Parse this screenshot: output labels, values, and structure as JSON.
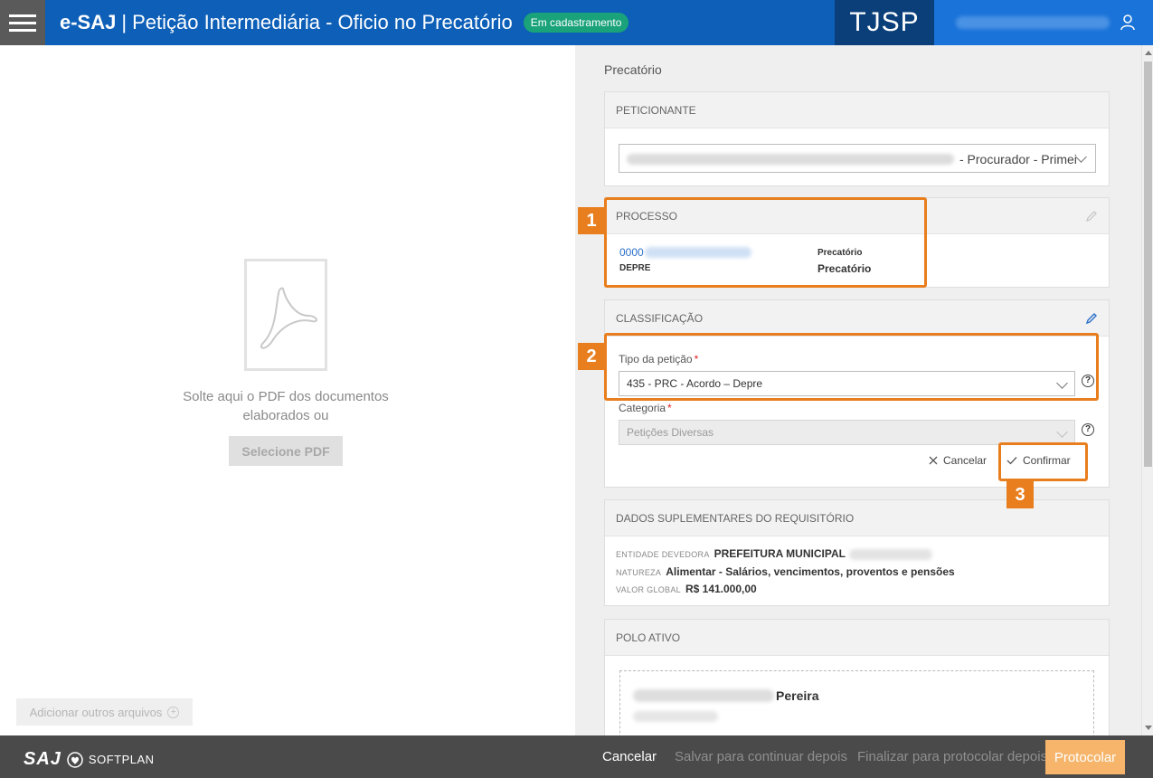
{
  "header": {
    "brand": "e-SAJ",
    "separator": "|",
    "title": "Petição Intermediária - Oficio no Precatório",
    "status": "Em cadastramento",
    "court": "TJSP"
  },
  "left": {
    "drop_text_line1": "Solte aqui o PDF dos documentos",
    "drop_text_line2": "elaborados ou",
    "select_pdf": "Selecione PDF",
    "add_files": "Adicionar outros arquivos"
  },
  "right": {
    "section_title": "Precatório",
    "peticionante": {
      "header": "PETICIONANTE",
      "selected_suffix": "- Procurador - Primei"
    },
    "processo": {
      "header": "PROCESSO",
      "number_prefix": "0000",
      "origin": "DEPRE",
      "class_label": "Precatório",
      "class_value": "Precatório"
    },
    "classificacao": {
      "header": "CLASSIFICAÇÃO",
      "tipo_label": "Tipo da petição",
      "tipo_value": "435 - PRC - Acordo – Depre",
      "categoria_label": "Categoria",
      "categoria_value": "Petições Diversas",
      "required_mark": "*",
      "help": "?",
      "cancel": "Cancelar",
      "confirm": "Confirmar"
    },
    "dados": {
      "header": "DADOS SUPLEMENTARES DO REQUISITÓRIO",
      "entidade_key": "ENTIDADE DEVEDORA",
      "entidade_value": "PREFEITURA MUNICIPAL",
      "natureza_key": "NATUREZA",
      "natureza_value": "Alimentar - Salários, vencimentos, proventos e pensões",
      "valor_key": "VALOR GLOBAL",
      "valor_value": "R$ 141.000,00"
    },
    "polo": {
      "header": "POLO ATIVO",
      "party_name": "Pereira"
    }
  },
  "markers": [
    "1",
    "2",
    "3"
  ],
  "footer": {
    "logo_saj": "SAJ",
    "logo_softplan": "SOFTPLAN",
    "cancel": "Cancelar",
    "save_later": "Salvar para continuar depois",
    "finalize_later": "Finalizar para protocolar depois",
    "protocolar": "Protocolar"
  },
  "colors": {
    "header_blue": "#0d5fb8",
    "court_blue": "#0a3f7a",
    "status_green": "#1aa37a",
    "highlight_orange": "#e87e1d",
    "protocolar_orange": "#f6b56b"
  }
}
